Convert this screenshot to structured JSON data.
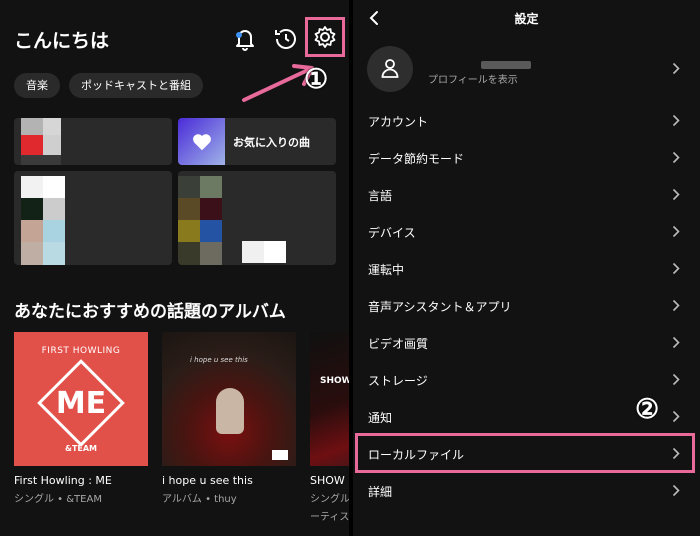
{
  "left": {
    "greeting": "こんにちは",
    "icons": [
      "bell-icon",
      "history-icon",
      "settings-gear-icon"
    ],
    "chips": [
      "音楽",
      "ポッドキャストと番組"
    ],
    "annotation_marker": "①",
    "liked_songs": "お気に入りの曲",
    "section_title": "あなたにおすすめの話題のアルバム",
    "albums": [
      {
        "title": "First Howling : ME",
        "subtitle": "シングル • &TEAM",
        "art_top": "FIRST HOWLING",
        "art_center": "ME",
        "art_bottom": "&TEAM"
      },
      {
        "title": "i hope u see this",
        "subtitle": "アルバム • thuy",
        "art_top": "i hope u see this"
      },
      {
        "title": "SHOW N",
        "subtitle": "シングル",
        "subtitle2": "ーティス",
        "art_top": "SHOW"
      }
    ]
  },
  "right": {
    "title": "設定",
    "profile_sub": "プロフィールを表示",
    "rows": [
      "アカウント",
      "データ節約モード",
      "言語",
      "デバイス",
      "運転中",
      "音声アシスタント＆アプリ",
      "ビデオ画質",
      "ストレージ",
      "通知",
      "ローカルファイル",
      "詳細"
    ],
    "annotation_marker": "②"
  },
  "colors": {
    "highlight": "#e86a9b",
    "background": "#121212",
    "subtext": "#a7a7a7"
  }
}
